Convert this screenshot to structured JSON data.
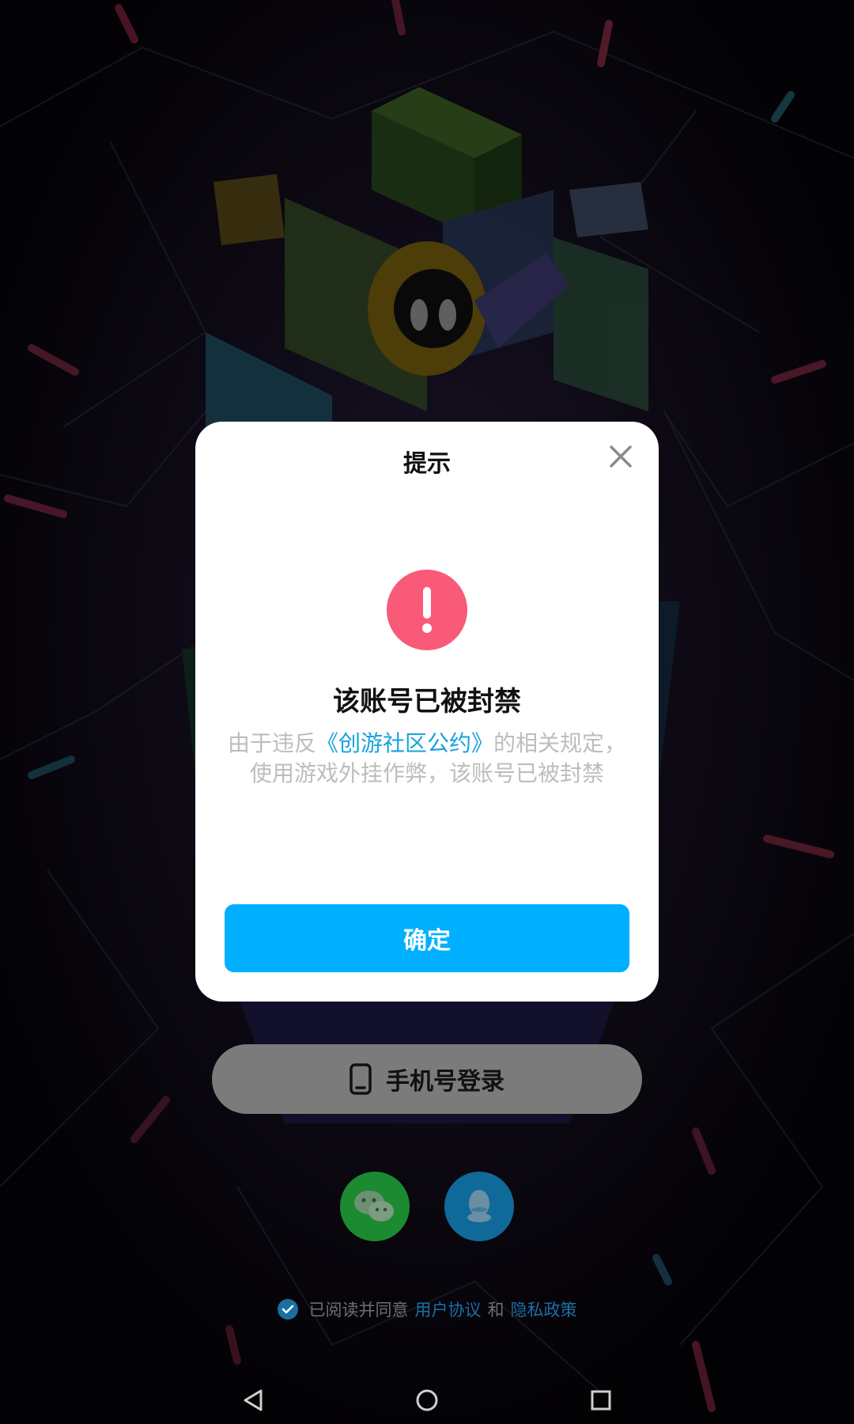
{
  "dialog": {
    "title": "提示",
    "ban_title": "该账号已被封禁",
    "message_prefix": "由于违反",
    "policy_link": "《创游社区公约》",
    "message_suffix": "的相关规定，使用游戏外挂作弊，该账号已被封禁",
    "confirm_label": "确定",
    "close_icon": "close-icon",
    "alert_icon": "exclamation-icon",
    "accent_color": "#00b0ff",
    "alert_color": "#f95a77"
  },
  "login": {
    "phone_login_label": "手机号登录",
    "phone_icon": "phone-icon",
    "wechat_icon": "wechat-icon",
    "qq_icon": "qq-icon"
  },
  "agreement": {
    "prefix": "已阅读并同意",
    "user_agreement": "用户协议",
    "and": "和",
    "privacy_policy": "隐私政策",
    "checked": true
  },
  "navbar": {
    "back_icon": "back-triangle-icon",
    "home_icon": "home-circle-icon",
    "recents_icon": "recents-square-icon"
  }
}
